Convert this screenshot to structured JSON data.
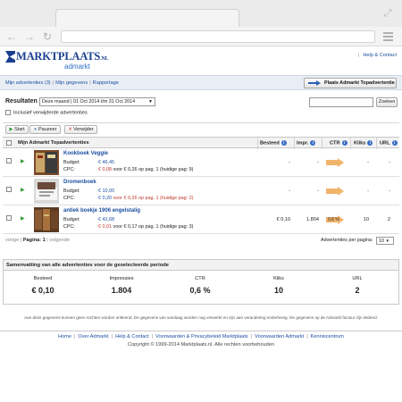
{
  "header": {
    "logo_main": "MARKTPLAATS",
    "logo_suffix": ".NL",
    "logo_sub": "admarkt",
    "help_contact": "Help & Contact"
  },
  "nav": {
    "links": [
      "Mijn advertenties (3)",
      "Mijn gegevens",
      "Rapportage"
    ],
    "place_button": "Plaats Admarkt Topadvertentie"
  },
  "filters": {
    "label": "Resultaten",
    "period": "Deze maand | 01 Oct 2014 t/m 31 Oct 2014",
    "search_button": "Zoeken",
    "search_value": "",
    "include_deleted": "Inclusief verwijderde advertenties"
  },
  "actions": {
    "start": "Start",
    "pause": "Pauzeer",
    "delete": "Verwijder"
  },
  "table": {
    "headers": {
      "title": "Mijn Admarkt Topadvertenties",
      "besteed": "Besteed",
      "impr": "Impr.",
      "ctr": "CTR",
      "kliks": "Kliks",
      "url": "URL"
    },
    "budget_label": "Budget:",
    "cpc_label": "CPC:",
    "rows": [
      {
        "title": "Kookboek Veggie",
        "budget": "€ 46,45",
        "cpc": "€ 0,08",
        "cpc_note": "voor € 0,26 op pag. 1 (huidige pag: 9)",
        "besteed": "-",
        "impr": "-",
        "ctr": "",
        "kliks": "-",
        "url": "-"
      },
      {
        "title": "Dromenboek",
        "budget": "€ 10,00",
        "cpc": "€ 0,20",
        "cpc_note": "voor € 0,26 op pag. 1 (huidige pag: 2)",
        "besteed": "-",
        "impr": "-",
        "ctr": "",
        "kliks": "-",
        "url": "-"
      },
      {
        "title": "antiek boekje 1906 engelstalig",
        "budget": "€ 42,68",
        "cpc": "€ 0,01",
        "cpc_note": "voor € 0,17 op pag. 1 (huidige pag: 3)",
        "besteed": "€ 0,10",
        "impr": "1.804",
        "ctr": "0,6 %",
        "kliks": "10",
        "url": "2"
      }
    ]
  },
  "pager": {
    "prev": "vorige",
    "page_label": "Pagina:",
    "page": "1",
    "next": "volgende",
    "per_page_label": "Advertenties per pagina:",
    "per_page": "10"
  },
  "summary": {
    "title": "Samenvatting van alle advertenties voor de geselecteerde periode",
    "columns": [
      {
        "label": "Besteed",
        "value": "€ 0,10"
      },
      {
        "label": "Impressies",
        "value": "1.804"
      },
      {
        "label": "CTR",
        "value": "0,6 %"
      },
      {
        "label": "Kliks",
        "value": "10"
      },
      {
        "label": "URL",
        "value": "2"
      }
    ]
  },
  "disclaimer": "Aan deze gegevens kunnen geen rechten worden ontleend. De gegevens van vandaag worden nog verwerkt en zijn aan verandering onderhevig. De gegevens op de Admarkt factuur zijn leidend.",
  "footer": {
    "links": [
      "Home",
      "Over Admarkt",
      "Help & Contact",
      "Voorwaarden & Privacybeleid Marktplaats",
      "Voorwaarden Admarkt",
      "Kenniscentrum"
    ],
    "copyright": "Copyright © 1999-2014 Marktplaats.nl. Alle rechten voorbehouden"
  },
  "colors": {
    "link": "#1b4fa0",
    "accent_red": "#c0392b",
    "ctr_arrow": "#f0b46a"
  }
}
